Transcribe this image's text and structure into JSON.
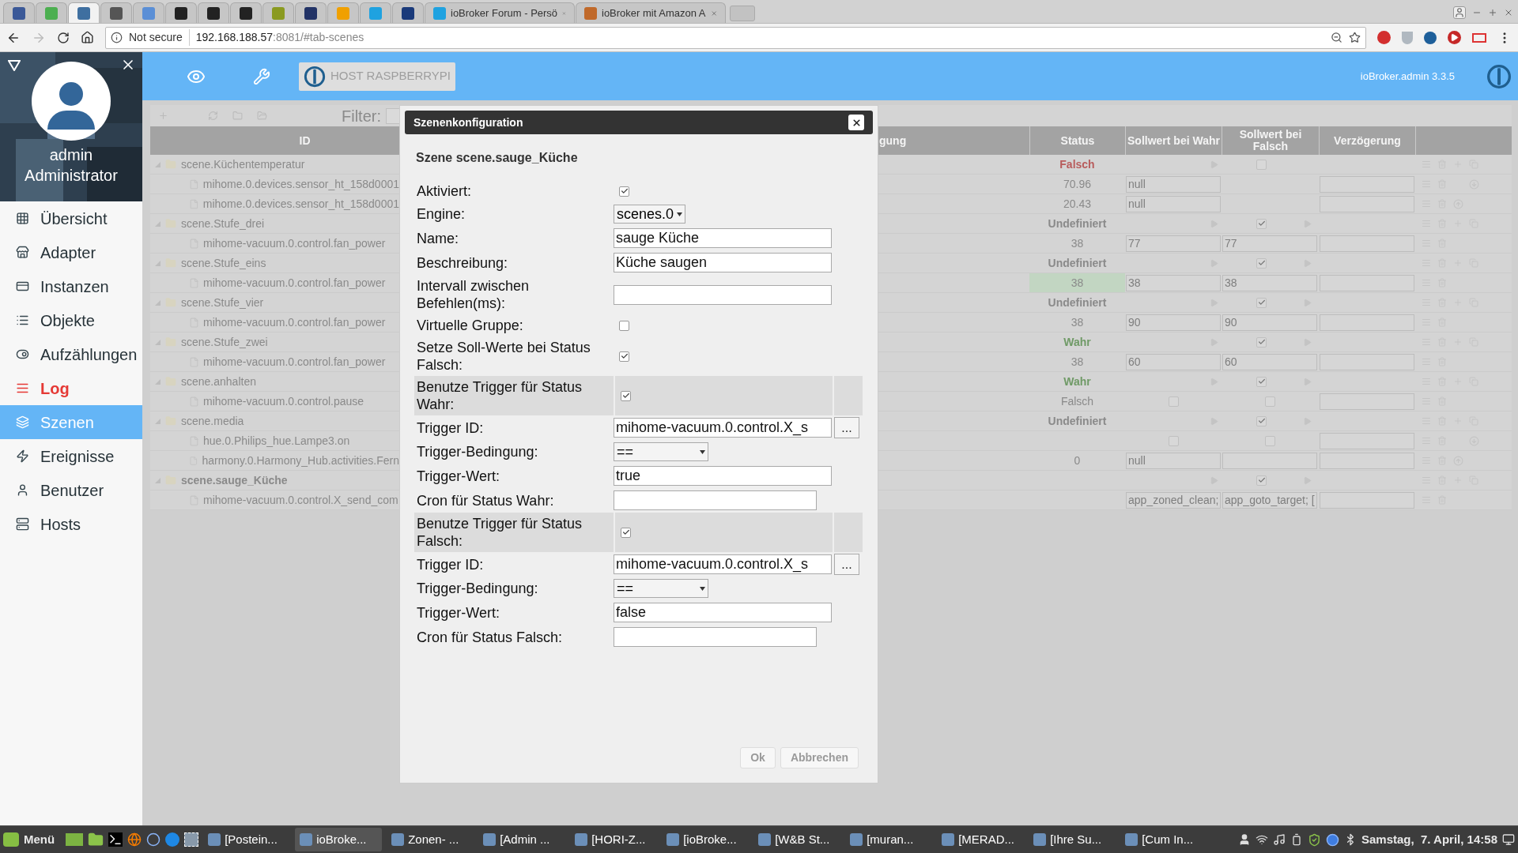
{
  "browser": {
    "tabs": [
      {
        "kind": "pinned",
        "color": "#3b5998",
        "selected": false
      },
      {
        "kind": "pinned",
        "color": "#4caf50",
        "selected": false
      },
      {
        "kind": "pinned",
        "color": "#3f6fa0",
        "selected": true
      },
      {
        "kind": "pinned",
        "color": "#555555",
        "selected": false
      },
      {
        "kind": "pinned",
        "color": "#5b8fd6",
        "selected": false
      },
      {
        "kind": "pinned",
        "color": "#222222",
        "selected": false
      },
      {
        "kind": "pinned",
        "color": "#222222",
        "selected": false
      },
      {
        "kind": "pinned",
        "color": "#222222",
        "selected": false
      },
      {
        "kind": "pinned",
        "color": "#8a9a20",
        "selected": false
      },
      {
        "kind": "pinned",
        "color": "#223366",
        "selected": false
      },
      {
        "kind": "pinned",
        "color": "#f0a000",
        "selected": false
      },
      {
        "kind": "pinned",
        "color": "#1fa2e0",
        "selected": false
      },
      {
        "kind": "pinned",
        "color": "#1a3a7a",
        "selected": false
      },
      {
        "kind": "titled",
        "color": "#1fa2e0",
        "title": "ioBroker Forum - Persö",
        "selected": false
      },
      {
        "kind": "titled",
        "color": "#c0692a",
        "title": "ioBroker mit Amazon A",
        "selected": false
      }
    ],
    "security": "Not secure",
    "url_host": "192.168.188.57",
    "url_rest": ":8081/#tab-scenes"
  },
  "header": {
    "host_button": "HOST RASPBERRYPI",
    "version": "ioBroker.admin 3.3.5"
  },
  "sidebar": {
    "user": "admin",
    "role": "Administrator",
    "items": [
      {
        "label": "Übersicht",
        "selected": false,
        "highlight": false
      },
      {
        "label": "Adapter",
        "selected": false,
        "highlight": false
      },
      {
        "label": "Instanzen",
        "selected": false,
        "highlight": false
      },
      {
        "label": "Objekte",
        "selected": false,
        "highlight": false
      },
      {
        "label": "Aufzählungen",
        "selected": false,
        "highlight": false
      },
      {
        "label": "Log",
        "selected": false,
        "highlight": true
      },
      {
        "label": "Szenen",
        "selected": true,
        "highlight": false
      },
      {
        "label": "Ereignisse",
        "selected": false,
        "highlight": false
      },
      {
        "label": "Benutzer",
        "selected": false,
        "highlight": false
      },
      {
        "label": "Hosts",
        "selected": false,
        "highlight": false
      }
    ]
  },
  "toolbar": {
    "filter_label": "Filter:"
  },
  "table": {
    "columns": [
      "ID",
      "gung",
      "Status",
      "Sollwert bei Wahr",
      "Sollwert bei Falsch",
      "Verzögerung"
    ],
    "scenes": [
      {
        "id": "scene.Küchentemperatur",
        "selected": false,
        "status": "Falsch",
        "color": "#b85c5c",
        "enabled": false,
        "false_play": false,
        "children": [
          {
            "id": "mihome.0.devices.sensor_ht_158d0001",
            "value": "70.96",
            "highlighted": false,
            "true_cell": {
              "kind": "field",
              "value": "null"
            },
            "false_cell": {
              "kind": "none"
            },
            "move_down": true,
            "move_up": false
          },
          {
            "id": "mihome.0.devices.sensor_ht_158d0001",
            "value": "20.43",
            "highlighted": false,
            "true_cell": {
              "kind": "field",
              "value": "null"
            },
            "false_cell": {
              "kind": "none"
            },
            "move_down": false,
            "move_up": true
          }
        ]
      },
      {
        "id": "scene.Stufe_drei",
        "selected": false,
        "status": "Undefiniert",
        "color": "#8a8a8a",
        "enabled": true,
        "false_play": true,
        "children": [
          {
            "id": "mihome-vacuum.0.control.fan_power",
            "value": "38",
            "highlighted": false,
            "true_cell": {
              "kind": "field",
              "value": "77"
            },
            "false_cell": {
              "kind": "field",
              "value": "77"
            }
          }
        ]
      },
      {
        "id": "scene.Stufe_eins",
        "selected": false,
        "status": "Undefiniert",
        "color": "#8a8a8a",
        "enabled": true,
        "false_play": true,
        "children": [
          {
            "id": "mihome-vacuum.0.control.fan_power",
            "value": "38",
            "highlighted": true,
            "true_cell": {
              "kind": "field",
              "value": "38"
            },
            "false_cell": {
              "kind": "field",
              "value": "38"
            }
          }
        ]
      },
      {
        "id": "scene.Stufe_vier",
        "selected": false,
        "status": "Undefiniert",
        "color": "#8a8a8a",
        "enabled": true,
        "false_play": true,
        "children": [
          {
            "id": "mihome-vacuum.0.control.fan_power",
            "value": "38",
            "highlighted": false,
            "true_cell": {
              "kind": "field",
              "value": "90"
            },
            "false_cell": {
              "kind": "field",
              "value": "90"
            }
          }
        ]
      },
      {
        "id": "scene.Stufe_zwei",
        "selected": false,
        "status": "Wahr",
        "color": "#6f9a66",
        "enabled": true,
        "false_play": true,
        "children": [
          {
            "id": "mihome-vacuum.0.control.fan_power",
            "value": "38",
            "highlighted": false,
            "true_cell": {
              "kind": "field",
              "value": "60"
            },
            "false_cell": {
              "kind": "field",
              "value": "60"
            }
          }
        ]
      },
      {
        "id": "scene.anhalten",
        "selected": false,
        "status": "Wahr",
        "color": "#6f9a66",
        "enabled": true,
        "false_play": true,
        "children": [
          {
            "id": "mihome-vacuum.0.control.pause",
            "value": "Falsch",
            "highlighted": false,
            "true_cell": {
              "kind": "checkbox",
              "checked": false
            },
            "false_cell": {
              "kind": "checkbox",
              "checked": false
            }
          }
        ]
      },
      {
        "id": "scene.media",
        "selected": false,
        "status": "Undefiniert",
        "color": "#8a8a8a",
        "enabled": true,
        "false_play": true,
        "children": [
          {
            "id": "hue.0.Philips_hue.Lampe3.on",
            "highlighted": false,
            "true_cell": {
              "kind": "checkbox",
              "checked": false
            },
            "false_cell": {
              "kind": "checkbox",
              "checked": false
            },
            "move_down": true,
            "move_up": false
          },
          {
            "id": "harmony.0.Harmony_Hub.activities.Fern",
            "value": "0",
            "highlighted": false,
            "true_cell": {
              "kind": "field",
              "value": "null"
            },
            "false_cell": {
              "kind": "field"
            },
            "move_down": false,
            "move_up": true
          }
        ]
      },
      {
        "id": "scene.sauge_Küche",
        "selected": true,
        "enabled": true,
        "false_play": true,
        "children": [
          {
            "id": "mihome-vacuum.0.control.X_send_com",
            "highlighted": false,
            "true_cell": {
              "kind": "field",
              "value": "app_zoned_clean;"
            },
            "false_cell": {
              "kind": "field",
              "value": "app_goto_target; ["
            }
          }
        ]
      }
    ]
  },
  "dialog": {
    "title": "Szenenkonfiguration",
    "heading": "Szene scene.sauge_Küche",
    "rows": [
      {
        "kind": "checkbox",
        "label": "Aktiviert:",
        "checked": true
      },
      {
        "kind": "select",
        "label": "Engine:",
        "value": "scenes.0"
      },
      {
        "kind": "text",
        "label": "Name:",
        "value": "sauge Küche"
      },
      {
        "kind": "text",
        "label": "Beschreibung:",
        "value": "Küche saugen"
      },
      {
        "kind": "text",
        "label": "Intervall zwischen Befehlen(ms):"
      },
      {
        "kind": "checkbox",
        "label": "Virtuelle Gruppe:",
        "checked": false
      },
      {
        "kind": "checkbox",
        "label": "Setze Soll-Werte bei Status Falsch:",
        "checked": true
      },
      {
        "kind": "section",
        "label": "Benutze Trigger für Status Wahr:",
        "checked": true
      },
      {
        "kind": "trigger",
        "label": "Trigger ID:",
        "value": "mihome-vacuum.0.control.X_s",
        "button": "..."
      },
      {
        "kind": "condition",
        "label": "Trigger-Bedingung:",
        "value": "=="
      },
      {
        "kind": "text",
        "label": "Trigger-Wert:",
        "value": "true"
      },
      {
        "kind": "cron",
        "label": "Cron für Status Wahr:"
      },
      {
        "kind": "section",
        "label": "Benutze Trigger für Status Falsch:",
        "checked": true
      },
      {
        "kind": "trigger",
        "label": "Trigger ID:",
        "value": "mihome-vacuum.0.control.X_s",
        "button": "..."
      },
      {
        "kind": "condition",
        "label": "Trigger-Bedingung:",
        "value": "=="
      },
      {
        "kind": "text",
        "label": "Trigger-Wert:",
        "value": "false"
      },
      {
        "kind": "cron",
        "label": "Cron für Status Falsch:"
      }
    ],
    "buttons": [
      "Ok",
      "Abbrechen"
    ]
  },
  "taskbar": {
    "menu": "Menü",
    "windows": [
      {
        "title": "[Postein...",
        "selected": false
      },
      {
        "title": "ioBroke...",
        "selected": true
      },
      {
        "title": "Zonen- ...",
        "selected": false
      },
      {
        "title": "[Admin ...",
        "selected": false
      },
      {
        "title": "[HORI-Z...",
        "selected": false
      },
      {
        "title": "[ioBroke...",
        "selected": false
      },
      {
        "title": "[W&B St...",
        "selected": false
      },
      {
        "title": "[muran...",
        "selected": false
      },
      {
        "title": "[MERAD...",
        "selected": false
      },
      {
        "title": "[Ihre Su...",
        "selected": false
      },
      {
        "title": "[Cum In...",
        "selected": false
      }
    ],
    "clock": "Samstag,  7. April, 14:58"
  }
}
